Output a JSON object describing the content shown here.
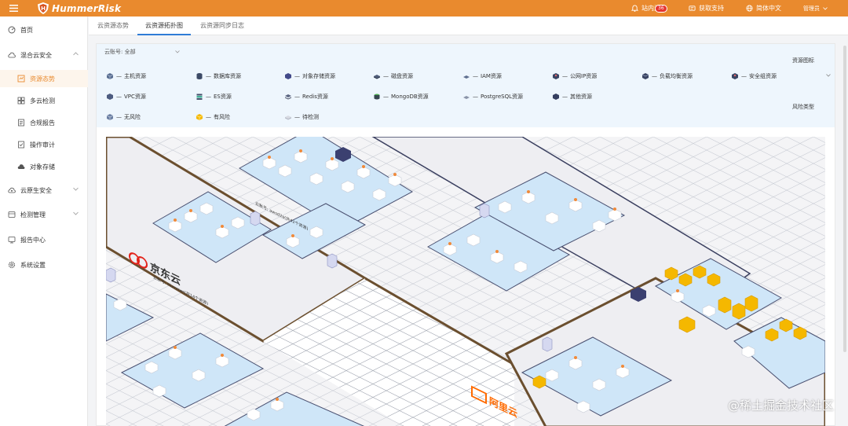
{
  "app": {
    "name": "HummerRisk"
  },
  "topbar": {
    "messages_label": "站内消息",
    "messages_count": "36",
    "support_label": "获取支持",
    "language_label": "简体中文",
    "user_label": "管理员"
  },
  "sidebar": {
    "items": [
      {
        "label": "首页",
        "icon": "dashboard-icon"
      },
      {
        "label": "混合云安全",
        "icon": "cloud-icon"
      },
      {
        "label": "资源态势",
        "icon": "resource-icon"
      },
      {
        "label": "多云检测",
        "icon": "scan-icon"
      },
      {
        "label": "合规报告",
        "icon": "report-icon"
      },
      {
        "label": "操作审计",
        "icon": "audit-icon"
      },
      {
        "label": "对象存储",
        "icon": "storage-icon"
      },
      {
        "label": "云原生安全",
        "icon": "cloud-native-icon"
      },
      {
        "label": "检测管理",
        "icon": "check-icon"
      },
      {
        "label": "报告中心",
        "icon": "report-center-icon"
      },
      {
        "label": "系统设置",
        "icon": "settings-icon"
      }
    ]
  },
  "tabs": [
    "云资源态势",
    "云资源拓扑图",
    "云资源同步日志"
  ],
  "filter": {
    "account_label": "云账号: 全部",
    "resource_icon_label": "资源图标",
    "risk_type_label": "风险类型",
    "legend_resources": [
      "主机资源",
      "数据库资源",
      "对象存储资源",
      "磁盘资源",
      "IAM资源",
      "公网IP资源",
      "负载均衡资源",
      "安全组资源",
      "VPC资源",
      "ES资源",
      "Redis资源",
      "MongoDB资源",
      "PostgreSQL资源",
      "其他资源"
    ],
    "legend_risks": [
      "无风险",
      "有风险",
      "待检测"
    ],
    "legend_prefix": "—"
  },
  "topology": {
    "provider_jd": "京东云",
    "provider_aliyun": "阿里云",
    "region_labels": [
      "云账号: awsd2a(共42个资源)",
      "云账号: Hummer(共14个资源)"
    ]
  },
  "watermark": "@稀土掘金技术社区",
  "colors": {
    "brand": "#e98a2e",
    "tab_active": "#2f7cd6",
    "filter_bg": "#eef6fd",
    "risk": "#f5b800",
    "badge": "#e6352f"
  }
}
